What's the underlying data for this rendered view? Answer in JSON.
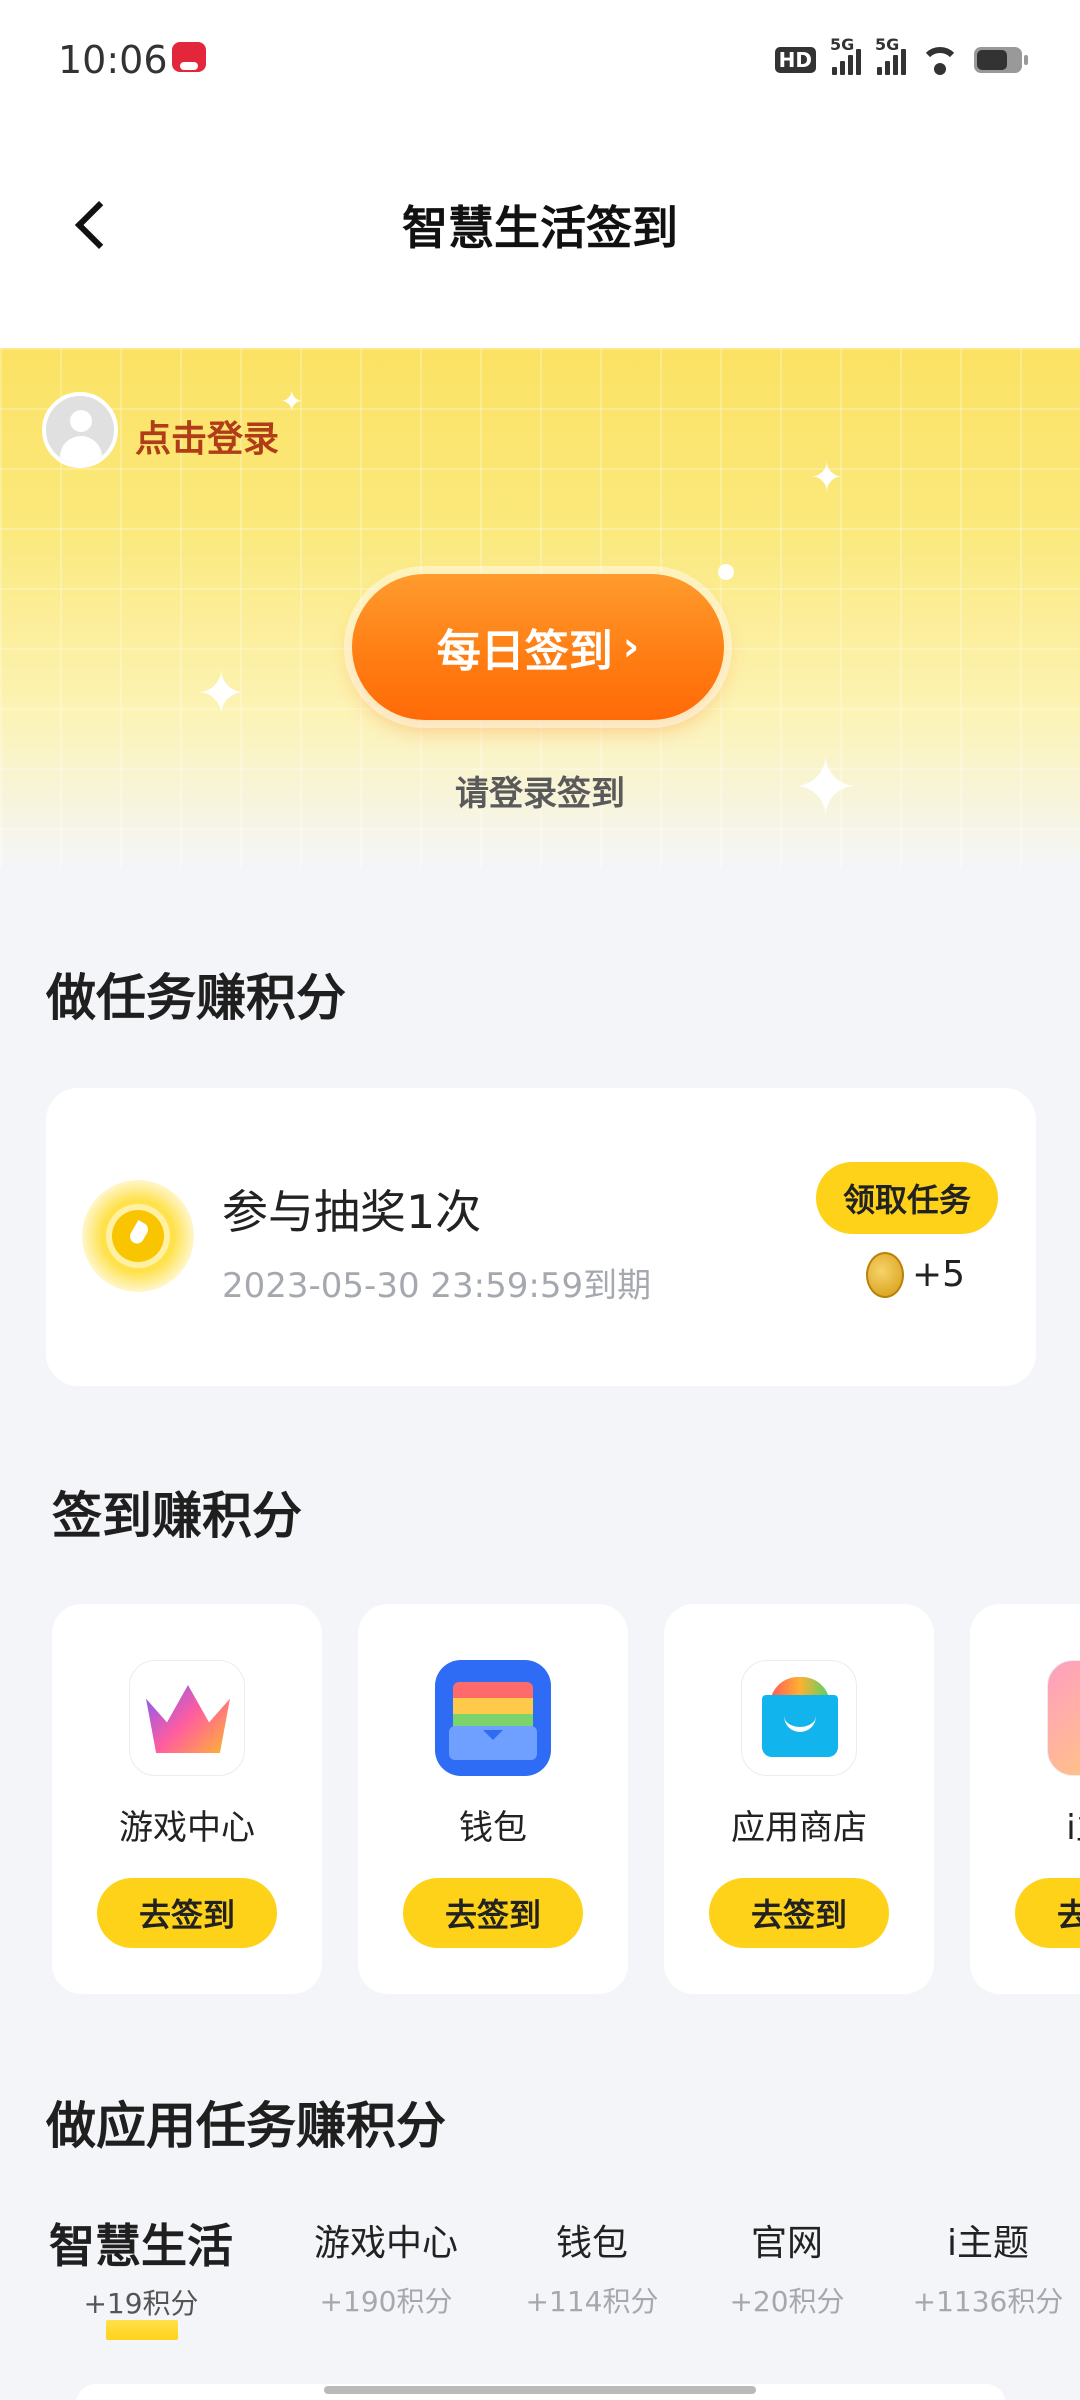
{
  "status_bar": {
    "time": "10:06",
    "hd_badge": "HD",
    "network_1": "5G",
    "network_2": "5G"
  },
  "header": {
    "title": "智慧生活签到"
  },
  "hero": {
    "login_text": "点击登录",
    "checkin_button": "每日签到",
    "checkin_chevron": "›",
    "hint": "请登录签到"
  },
  "tasks_section": {
    "title": "做任务赚积分",
    "items": [
      {
        "title": "参与抽奖1次",
        "deadline": "2023-05-30 23:59:59到期",
        "action": "领取任务",
        "reward": "+5"
      }
    ]
  },
  "signin_section": {
    "title": "签到赚积分",
    "apps": [
      {
        "name": "游戏中心",
        "action": "去签到",
        "icon": "game-center-icon"
      },
      {
        "name": "钱包",
        "action": "去签到",
        "icon": "wallet-icon"
      },
      {
        "name": "应用商店",
        "action": "去签到",
        "icon": "app-store-icon"
      },
      {
        "name": "i主题",
        "action": "去签到",
        "icon": "theme-icon"
      }
    ]
  },
  "app_tasks_section": {
    "title": "做应用任务赚积分",
    "tabs": [
      {
        "name": "智慧生活",
        "points": "+19积分",
        "active": true
      },
      {
        "name": "游戏中心",
        "points": "+190积分"
      },
      {
        "name": "钱包",
        "points": "+114积分"
      },
      {
        "name": "官网",
        "points": "+20积分"
      },
      {
        "name": "i主题",
        "points": "+1136积分"
      }
    ]
  },
  "colors": {
    "accent_yellow": "#ffd21a",
    "checkin_orange": "#ff7c12",
    "login_text": "#b03c18",
    "background": "#f4f5f9"
  }
}
